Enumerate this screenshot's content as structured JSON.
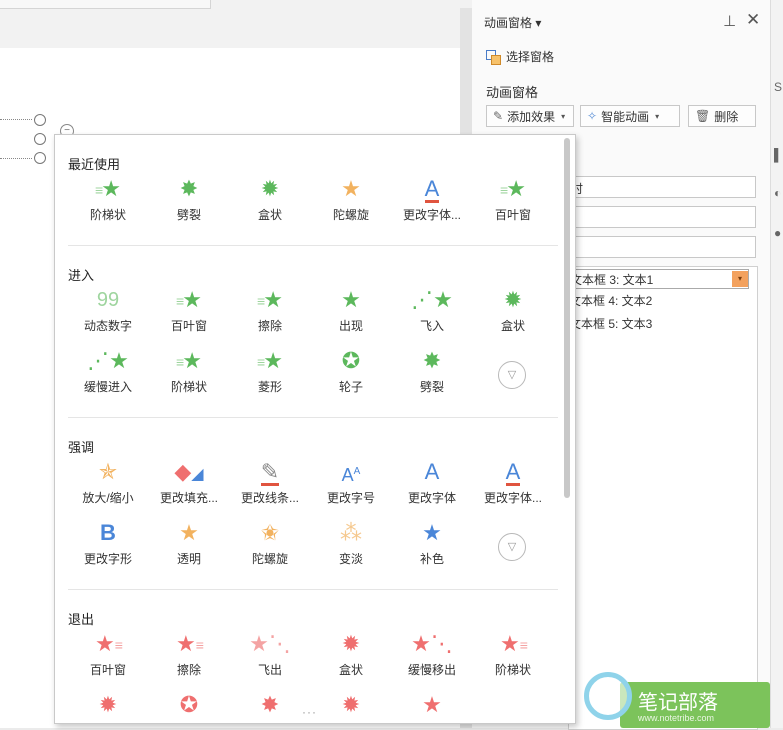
{
  "pane": {
    "title": "动画窗格",
    "selection_pane": "选择窗格",
    "section_label": "动画窗格",
    "add_effect": "添加效果",
    "smart_anim": "智能动画",
    "delete": "删除",
    "combos": [
      "时",
      "",
      ")"
    ],
    "list_items": [
      "文本框 3: 文本1",
      "文本框 4: 文本2",
      "文本框 5: 文本3"
    ]
  },
  "dropdown": {
    "recent": {
      "title": "最近使用",
      "items": [
        {
          "label": "阶梯状",
          "icon": "stairs-star-icon"
        },
        {
          "label": "劈裂",
          "icon": "split-star-icon"
        },
        {
          "label": "盒状",
          "icon": "box-star-icon"
        },
        {
          "label": "陀螺旋",
          "icon": "spin-star-icon"
        },
        {
          "label": "更改字体...",
          "icon": "font-a-icon"
        },
        {
          "label": "百叶窗",
          "icon": "blinds-star-icon"
        }
      ]
    },
    "enter": {
      "title": "进入",
      "items": [
        {
          "label": "动态数字",
          "icon": "digits-icon",
          "glyph": "99"
        },
        {
          "label": "百叶窗",
          "icon": "blinds-star-icon"
        },
        {
          "label": "擦除",
          "icon": "wipe-star-icon"
        },
        {
          "label": "出现",
          "icon": "appear-star-icon"
        },
        {
          "label": "飞入",
          "icon": "fly-in-star-icon"
        },
        {
          "label": "盒状",
          "icon": "box-star-icon"
        },
        {
          "label": "缓慢进入",
          "icon": "slow-in-star-icon"
        },
        {
          "label": "阶梯状",
          "icon": "stairs-star-icon"
        },
        {
          "label": "菱形",
          "icon": "diamond-star-icon"
        },
        {
          "label": "轮子",
          "icon": "wheel-star-icon"
        },
        {
          "label": "劈裂",
          "icon": "split-star-icon"
        }
      ]
    },
    "emphasis": {
      "title": "强调",
      "items": [
        {
          "label": "放大/缩小",
          "icon": "grow-star-icon"
        },
        {
          "label": "更改填充...",
          "icon": "fill-bucket-icon"
        },
        {
          "label": "更改线条...",
          "icon": "line-pen-icon"
        },
        {
          "label": "更改字号",
          "icon": "font-size-icon"
        },
        {
          "label": "更改字体",
          "icon": "font-a-icon"
        },
        {
          "label": "更改字体...",
          "icon": "font-a-underline-icon"
        },
        {
          "label": "更改字形",
          "icon": "bold-b-icon",
          "glyph": "B"
        },
        {
          "label": "透明",
          "icon": "transparent-star-icon"
        },
        {
          "label": "陀螺旋",
          "icon": "spin-star-icon"
        },
        {
          "label": "变淡",
          "icon": "fade-star-icon"
        },
        {
          "label": "补色",
          "icon": "complement-star-icon"
        }
      ]
    },
    "exit": {
      "title": "退出",
      "items": [
        {
          "label": "百叶窗",
          "icon": "blinds-star-icon"
        },
        {
          "label": "擦除",
          "icon": "wipe-star-icon"
        },
        {
          "label": "飞出",
          "icon": "fly-out-star-icon"
        },
        {
          "label": "盒状",
          "icon": "box-star-icon"
        },
        {
          "label": "缓慢移出",
          "icon": "slow-out-star-icon"
        },
        {
          "label": "阶梯状",
          "icon": "stairs-star-icon"
        }
      ]
    }
  },
  "watermark": {
    "text": "笔记部落",
    "url": "www.notetribe.com"
  },
  "colors": {
    "enter": "#5cb85c",
    "emphasis": "#f2b25f",
    "exit": "#ef6f6f",
    "font": "#4a86d8",
    "accent": "#f3a15d"
  }
}
